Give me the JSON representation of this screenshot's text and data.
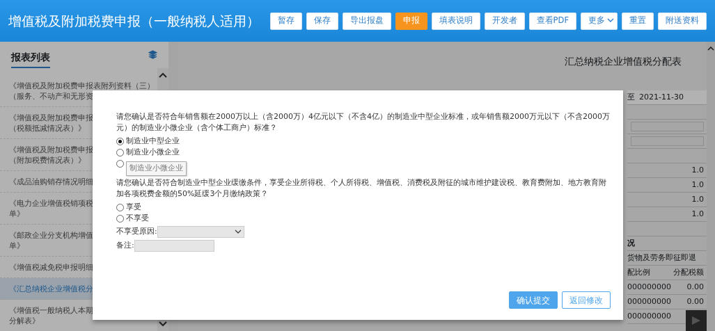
{
  "header": {
    "title": "增值税及附加税费申报（一般纳税人适用）",
    "buttons": [
      {
        "label": "暂存",
        "selected": false,
        "kind": "plain"
      },
      {
        "label": "保存",
        "selected": false,
        "kind": "plain"
      },
      {
        "label": "导出报盘",
        "selected": false,
        "kind": "plain"
      },
      {
        "label": "申报",
        "selected": true,
        "kind": "plain"
      },
      {
        "label": "填表说明",
        "selected": false,
        "kind": "plain"
      },
      {
        "label": "开发者",
        "selected": false,
        "kind": "plain"
      },
      {
        "label": "查看PDF",
        "selected": false,
        "kind": "plain"
      },
      {
        "label": "更多",
        "selected": false,
        "kind": "dropdown"
      },
      {
        "label": "重置",
        "selected": false,
        "kind": "plain"
      },
      {
        "label": "附送资料",
        "selected": false,
        "kind": "plain"
      }
    ]
  },
  "sidebar": {
    "title": "报表列表",
    "items": [
      {
        "lines": [
          "《增值税及附加税费申报表附列资料（三）",
          "（服务、不动产和无形资"
        ],
        "selected": false
      },
      {
        "lines": [
          "《增值税及附加税费申报",
          "（税额抵减情况表）》"
        ],
        "selected": false
      },
      {
        "lines": [
          "《增值税及附加税费申报",
          "（附加税费情况表）》"
        ],
        "selected": false
      },
      {
        "lines": [
          "《成品油购销存情况明细"
        ],
        "selected": false
      },
      {
        "lines": [
          "《电力企业增值税销项税",
          "单》"
        ],
        "selected": false
      },
      {
        "lines": [
          "《邮政企业分支机构增值",
          "单》"
        ],
        "selected": false
      },
      {
        "lines": [
          "《增值税减免税申报明细"
        ],
        "selected": false
      },
      {
        "lines": [
          "《汇总纳税企业增值税分"
        ],
        "selected": true
      },
      {
        "lines": [
          "《增值税一般纳税人本期",
          "分解表》"
        ],
        "selected": false
      }
    ]
  },
  "main": {
    "title": "汇总纳税企业增值税分配表",
    "period_separator": "至",
    "period_end": "2021-11-30",
    "values": [
      "1.0",
      "1.0",
      "1.0",
      "1.0"
    ],
    "section": "况",
    "table": {
      "group": "货物及劳务即征即退",
      "columns": [
        "配比例",
        "分配税额"
      ],
      "rows": [
        [
          "000000000",
          "0.00"
        ],
        [
          "000000000",
          "0.00"
        ],
        [
          "000000000"
        ]
      ]
    }
  },
  "dialog": {
    "question_1": "请您确认是否符合年销售额在2000万以上（含2000万）4亿元以下（不含4亿）的制造业中型企业标准，或年销售额2000万元以下（不含2000万元）的制造业小微企业（含个体工商户）标准？",
    "options_1": [
      {
        "label": "制造业中型企业",
        "selected": true
      },
      {
        "label": "制造业小微企业",
        "selected": false
      },
      {
        "selected": false
      }
    ],
    "tooltip": "制造业小微企业",
    "question_2": "请您确认是否符合制造业中型企业缓缴条件，享受企业所得税、个人所得税、增值税、消费税及附征的城市维护建设税、教育费附加、地方教育附加各项税费金额的50%延缓3个月缴纳政策？",
    "options_2": [
      {
        "label": "享受",
        "selected": false
      },
      {
        "label": "不享受",
        "selected": false
      }
    ],
    "reason_label": "不享受原因:",
    "note_label": "备注:",
    "buttons": [
      {
        "label": "确认提交",
        "kind": "primary"
      },
      {
        "label": "返回修改",
        "kind": "outline"
      }
    ]
  }
}
